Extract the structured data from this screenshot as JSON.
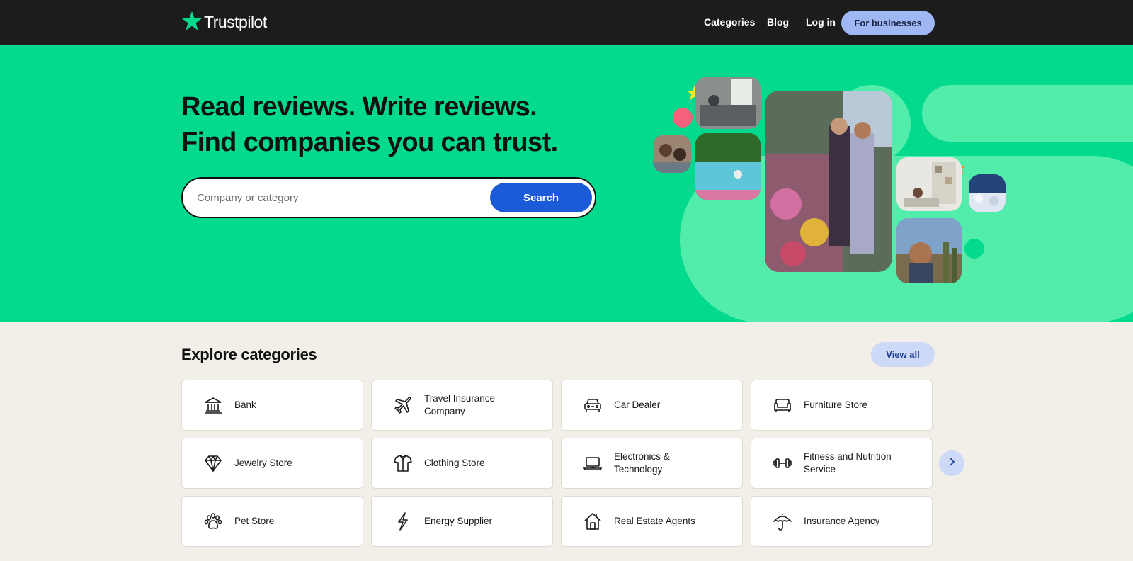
{
  "header": {
    "logo_text": "Trustpilot",
    "nav": [
      "Categories",
      "Blog",
      "Log in"
    ],
    "business_label": "For businesses"
  },
  "hero": {
    "headline_line1": "Read reviews. Write reviews.",
    "headline_line2": "Find companies you can trust.",
    "search_placeholder": "Company or category",
    "search_button": "Search"
  },
  "categories": {
    "title": "Explore categories",
    "view_all": "View all",
    "items": [
      {
        "label": "Bank",
        "icon": "bank-icon"
      },
      {
        "label": "Travel Insurance Company",
        "icon": "airplane-icon"
      },
      {
        "label": "Car Dealer",
        "icon": "car-icon"
      },
      {
        "label": "Furniture Store",
        "icon": "sofa-icon"
      },
      {
        "label": "Jewelry Store",
        "icon": "diamond-icon"
      },
      {
        "label": "Clothing Store",
        "icon": "shirt-icon"
      },
      {
        "label": "Electronics & Technology",
        "icon": "laptop-icon"
      },
      {
        "label": "Fitness and Nutrition Service",
        "icon": "dumbbell-icon"
      },
      {
        "label": "Pet Store",
        "icon": "paw-icon"
      },
      {
        "label": "Energy Supplier",
        "icon": "lightning-icon"
      },
      {
        "label": "Real Estate Agents",
        "icon": "house-icon"
      },
      {
        "label": "Insurance Agency",
        "icon": "umbrella-icon"
      }
    ]
  },
  "colors": {
    "header_bg": "#1c1c1c",
    "hero_bg": "#04da8d",
    "brand_star": "#04da8d",
    "search_button": "#1c5bd8",
    "page_bg": "#f1efe8"
  }
}
